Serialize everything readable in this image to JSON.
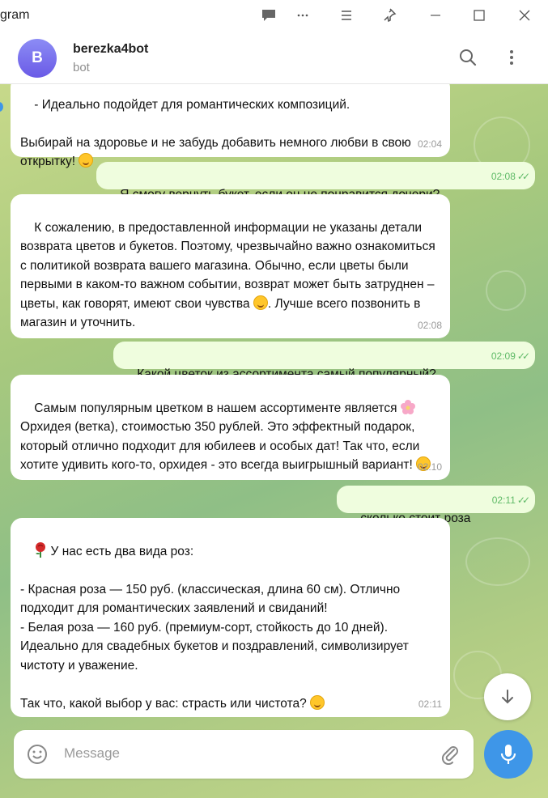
{
  "window": {
    "title": "gram"
  },
  "header": {
    "avatar_letter": "B",
    "name": "berezka4bot",
    "status": "bot"
  },
  "messages": [
    {
      "dir": "in",
      "text": "- Идеально подойдет для романтических композиций.\n\nВыбирай на здоровье и не забудь добавить немного любви в свою открытку! ",
      "emoji": "smile",
      "time": "02:04"
    },
    {
      "dir": "out",
      "text": "Я смогу вернуть букет, если он не понравится дочери?",
      "time": "02:08"
    },
    {
      "dir": "in",
      "text_a": "К сожалению, в предоставленной информации не указаны детали возврата цветов и букетов. Поэтому, чрезвычайно важно ознакомиться с политикой возврата вашего магазина. Обычно, если цветы были первыми в каком-то важном событии, возврат может быть затруднен – цветы, как говорят, имеют свои чувства ",
      "text_b": ". Лучше всего позвонить в магазин и уточнить.",
      "emoji": "sweat-smile",
      "time": "02:08"
    },
    {
      "dir": "out",
      "text": "Какой цветок из ассортимента самый популярный?",
      "time": "02:09"
    },
    {
      "dir": "in",
      "text_a": "Самым популярным цветком в нашем ассортименте является ",
      "text_b": " Орхидея (ветка), стоимостью 350 рублей. Это эффектный подарок, который отлично подходит для юбилеев и особых дат! Так что, если хотите удивить кого-то, орхидея - это всегда выигрышный вариант! ",
      "emoji": "blossom",
      "time": "02:10"
    },
    {
      "dir": "out",
      "text": "сколько стоит роза",
      "time": "02:11"
    },
    {
      "dir": "in",
      "text_a": " У нас есть два вида роз:\n\n- Красная роза — 150 руб. (классическая, длина 60 см). Отлично подходит для романтических заявлений и свиданий!\n- Белая роза — 160 руб. (премиум-сорт, стойкость до 10 дней). Идеально для свадебных букетов и поздравлений, символизирует чистоту и уважение.\n\nТак что, какой выбор у вас: страсть или чистота? ",
      "emoji": "rose",
      "time": "02:11"
    }
  ],
  "composer": {
    "placeholder": "Message"
  },
  "colors": {
    "accent": "#3e96e8",
    "outgoing_bubble": "#effdde",
    "incoming_bubble": "#ffffff"
  }
}
